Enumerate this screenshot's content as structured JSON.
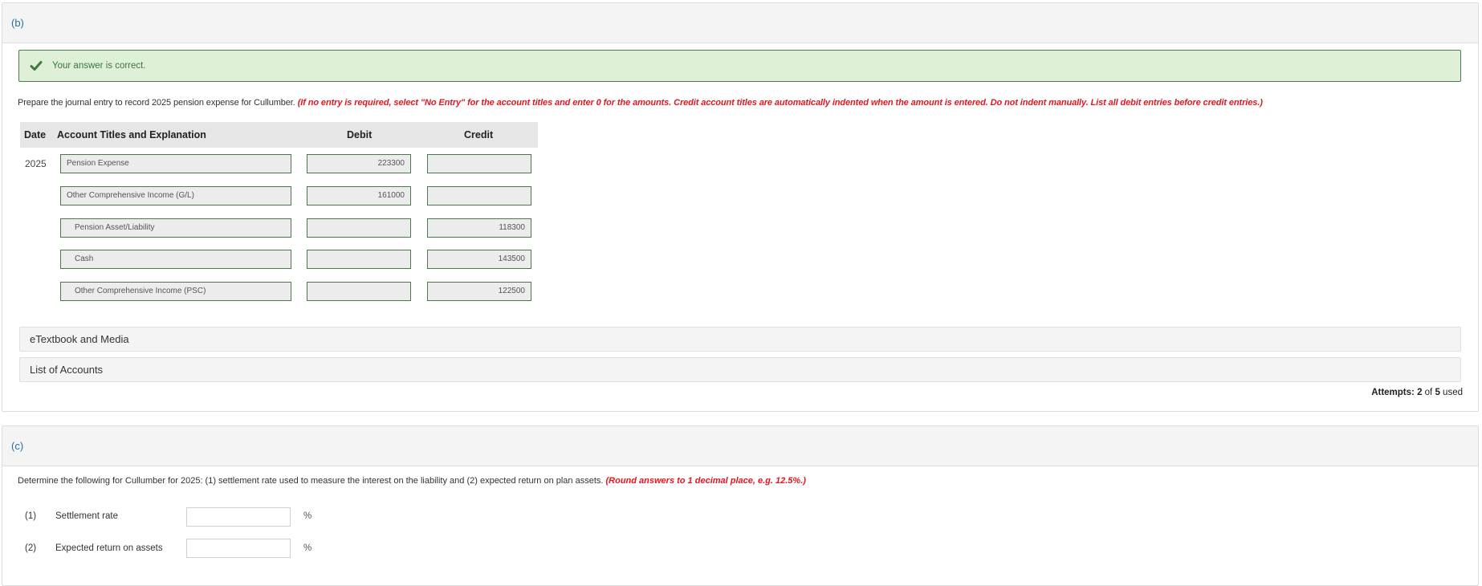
{
  "section_b": {
    "label": "(b)",
    "feedback": {
      "icon": "check-icon",
      "text": "Your answer is correct.",
      "color": "#3c763d"
    },
    "instruction": "Prepare the journal entry to record 2025 pension expense for Cullumber.",
    "instruction_note": "(If no entry is required, select \"No Entry\" for the account titles and enter 0 for the amounts. Credit account titles are automatically indented when the amount is entered. Do not indent manually. List all debit entries before credit entries.)",
    "table": {
      "headers": {
        "date": "Date",
        "account": "Account Titles and Explanation",
        "debit": "Debit",
        "credit": "Credit"
      },
      "rows": [
        {
          "date": "2025",
          "account": "Pension Expense",
          "debit": "223300",
          "credit": ""
        },
        {
          "date": "",
          "account": "Other Comprehensive Income (G/L)",
          "debit": "161000",
          "credit": ""
        },
        {
          "date": "",
          "account": "Pension Asset/Liability",
          "debit": "",
          "credit": "118300"
        },
        {
          "date": "",
          "account": "Cash",
          "debit": "",
          "credit": "143500"
        },
        {
          "date": "",
          "account": "Other Comprehensive Income (PSC)",
          "debit": "",
          "credit": "122500"
        }
      ]
    },
    "etextbook": "eTextbook and Media",
    "list_of_accounts": "List of Accounts",
    "attempts_prefix": "Attempts: ",
    "attempts_used": "2",
    "attempts_mid": " of ",
    "attempts_total": "5",
    "attempts_suffix": " used"
  },
  "section_c": {
    "label": "(c)",
    "instruction": "Determine the following for Cullumber for 2025: (1) settlement rate used to measure the interest on the liability and (2) expected return on plan assets.",
    "instruction_note": "(Round answers to 1 decimal place, e.g. 12.5%.)",
    "questions": [
      {
        "num": "(1)",
        "label": "Settlement rate",
        "value": "",
        "unit": "%"
      },
      {
        "num": "(2)",
        "label": "Expected return on assets",
        "value": "",
        "unit": "%"
      }
    ]
  },
  "colors": {
    "accent_label": "#2a6f97",
    "note_red": "#e8141e",
    "input_border": "#4a7a4a",
    "success_bg": "#dff0d8"
  }
}
